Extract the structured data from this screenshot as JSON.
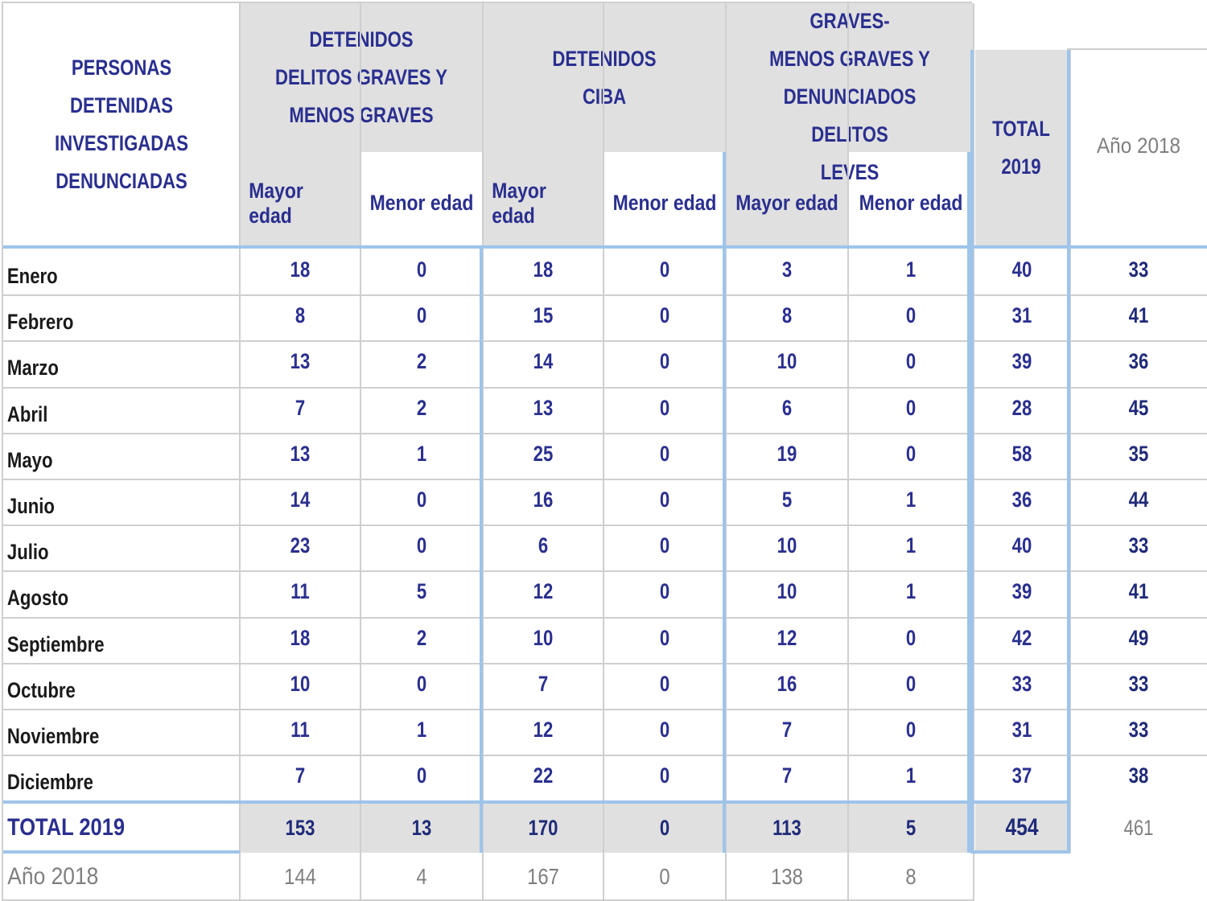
{
  "headers": {
    "row_header": "PERSONAS\nDETENIDAS\nINVESTIGADAS\nDENUNCIADAS",
    "group1": "DETENIDOS\nDELITOS GRAVES Y\nMENOS GRAVES",
    "group2": "DETENIDOS\nCIBA",
    "group3": "INVESTIGADOS GRAVES-\nMENOS GRAVES Y\nDENUNCIADOS DELITOS\nLEVES",
    "total": "TOTAL\n2019",
    "year_prev": "Año 2018",
    "sub_mayor": "Mayor edad",
    "sub_menor": "Menor edad"
  },
  "rows": [
    {
      "month": "Enero",
      "values": [
        "18",
        "0",
        "18",
        "0",
        "3",
        "1"
      ],
      "total": "40",
      "prev": "33"
    },
    {
      "month": "Febrero",
      "values": [
        "8",
        "0",
        "15",
        "0",
        "8",
        "0"
      ],
      "total": "31",
      "prev": "41"
    },
    {
      "month": "Marzo",
      "values": [
        "13",
        "2",
        "14",
        "0",
        "10",
        "0"
      ],
      "total": "39",
      "prev": "36"
    },
    {
      "month": "Abril",
      "values": [
        "7",
        "2",
        "13",
        "0",
        "6",
        "0"
      ],
      "total": "28",
      "prev": "45"
    },
    {
      "month": "Mayo",
      "values": [
        "13",
        "1",
        "25",
        "0",
        "19",
        "0"
      ],
      "total": "58",
      "prev": "35"
    },
    {
      "month": "Junio",
      "values": [
        "14",
        "0",
        "16",
        "0",
        "5",
        "1"
      ],
      "total": "36",
      "prev": "44"
    },
    {
      "month": "Julio",
      "values": [
        "23",
        "0",
        "6",
        "0",
        "10",
        "1"
      ],
      "total": "40",
      "prev": "33"
    },
    {
      "month": "Agosto",
      "values": [
        "11",
        "5",
        "12",
        "0",
        "10",
        "1"
      ],
      "total": "39",
      "prev": "41"
    },
    {
      "month": "Septiembre",
      "values": [
        "18",
        "2",
        "10",
        "0",
        "12",
        "0"
      ],
      "total": "42",
      "prev": "49"
    },
    {
      "month": "Octubre",
      "values": [
        "10",
        "0",
        "7",
        "0",
        "16",
        "0"
      ],
      "total": "33",
      "prev": "33"
    },
    {
      "month": "Noviembre",
      "values": [
        "11",
        "1",
        "12",
        "0",
        "7",
        "0"
      ],
      "total": "31",
      "prev": "33"
    },
    {
      "month": "Diciembre",
      "values": [
        "7",
        "0",
        "22",
        "0",
        "7",
        "1"
      ],
      "total": "37",
      "prev": "38"
    }
  ],
  "total_row": {
    "label": "TOTAL 2019",
    "values": [
      "153",
      "13",
      "170",
      "0",
      "113",
      "5"
    ],
    "total": "454",
    "prev": "461"
  },
  "prev_row": {
    "label": "Año 2018",
    "values": [
      "144",
      "4",
      "167",
      "0",
      "138",
      "8"
    ]
  }
}
